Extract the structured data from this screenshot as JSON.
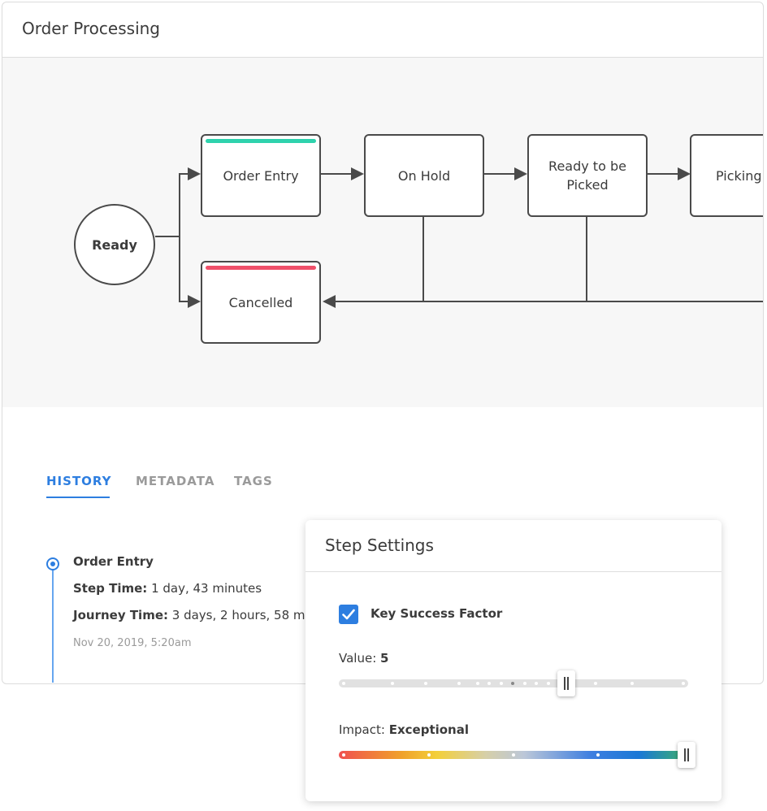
{
  "header": {
    "title": "Order Processing"
  },
  "flow": {
    "start_label": "Ready",
    "nodes": [
      {
        "id": "order-entry",
        "label": "Order Entry",
        "status_color": "#2ed2ad"
      },
      {
        "id": "on-hold",
        "label": "On Hold"
      },
      {
        "id": "ready-to-be-picked",
        "label": "Ready to be Picked"
      },
      {
        "id": "picking",
        "label": "Picking"
      },
      {
        "id": "cancelled",
        "label": "Cancelled",
        "status_color": "#f0506a"
      }
    ]
  },
  "tabs": [
    {
      "label": "HISTORY",
      "active": true
    },
    {
      "label": "METADATA",
      "active": false
    },
    {
      "label": "TAGS",
      "active": false
    }
  ],
  "history": {
    "entry_title": "Order Entry",
    "step_time_label": "Step Time:",
    "step_time_value": "1 day, 43 minutes",
    "journey_time_label": "Journey Time:",
    "journey_time_value": "3 days, 2 hours, 58 m",
    "date": "Nov 20, 2019, 5:20am"
  },
  "step_settings": {
    "title": "Step Settings",
    "key_success_factor": {
      "label": "Key Success Factor",
      "checked": true
    },
    "value": {
      "label": "Value:",
      "value": "5",
      "fraction": 0.65
    },
    "impact": {
      "label": "Impact:",
      "value": "Exceptional",
      "fraction": 1.0
    }
  },
  "colors": {
    "accent": "#2d7ee0",
    "success_bar": "#2ed2ad",
    "cancel_bar": "#f0506a"
  }
}
